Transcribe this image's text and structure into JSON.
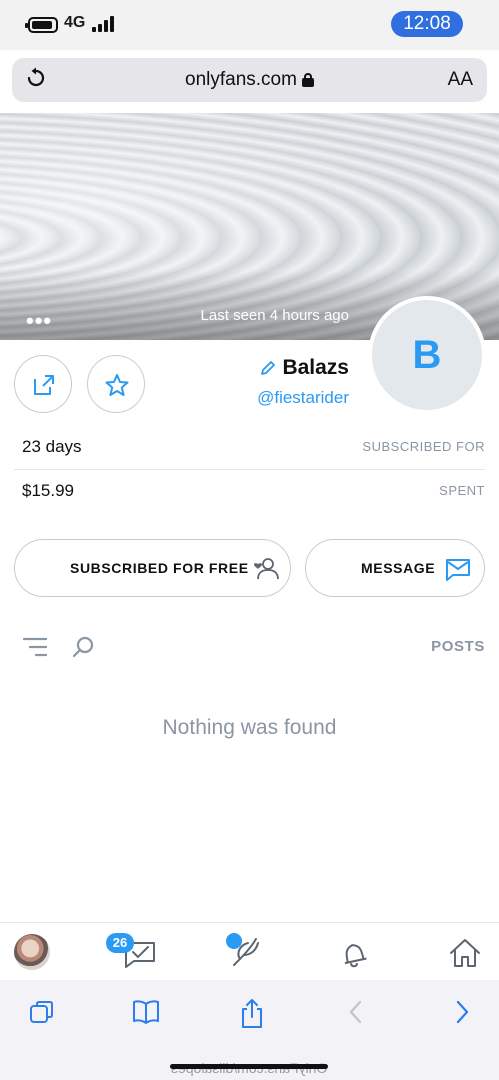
{
  "status_bar": {
    "time": "12:08",
    "network": "4G"
  },
  "address_bar": {
    "url": "onlyfans.com",
    "text_size_label": "AA"
  },
  "profile": {
    "last_seen": "Last seen 4 hours ago",
    "avatar_letter": "B",
    "name": "Balazs",
    "handle": "@fiestarider"
  },
  "stats": [
    {
      "label": "SUBSCRIBED FOR",
      "value": "23 days"
    },
    {
      "label": "SPENT",
      "value": "$15.99"
    }
  ],
  "actions": {
    "message_label": "MESSAGE",
    "subscribed_label": "SUBSCRIBED FOR FREE"
  },
  "posts": {
    "header": "POSTS",
    "empty_text": "Nothing was found"
  },
  "bottom_nav": {
    "messages_badge": "26"
  },
  "watermark": "OnlyFans.com/dilsalopes",
  "colors": {
    "accent": "#2b9af3",
    "time_pill": "#2f6fe0",
    "muted": "#8a96a3"
  }
}
